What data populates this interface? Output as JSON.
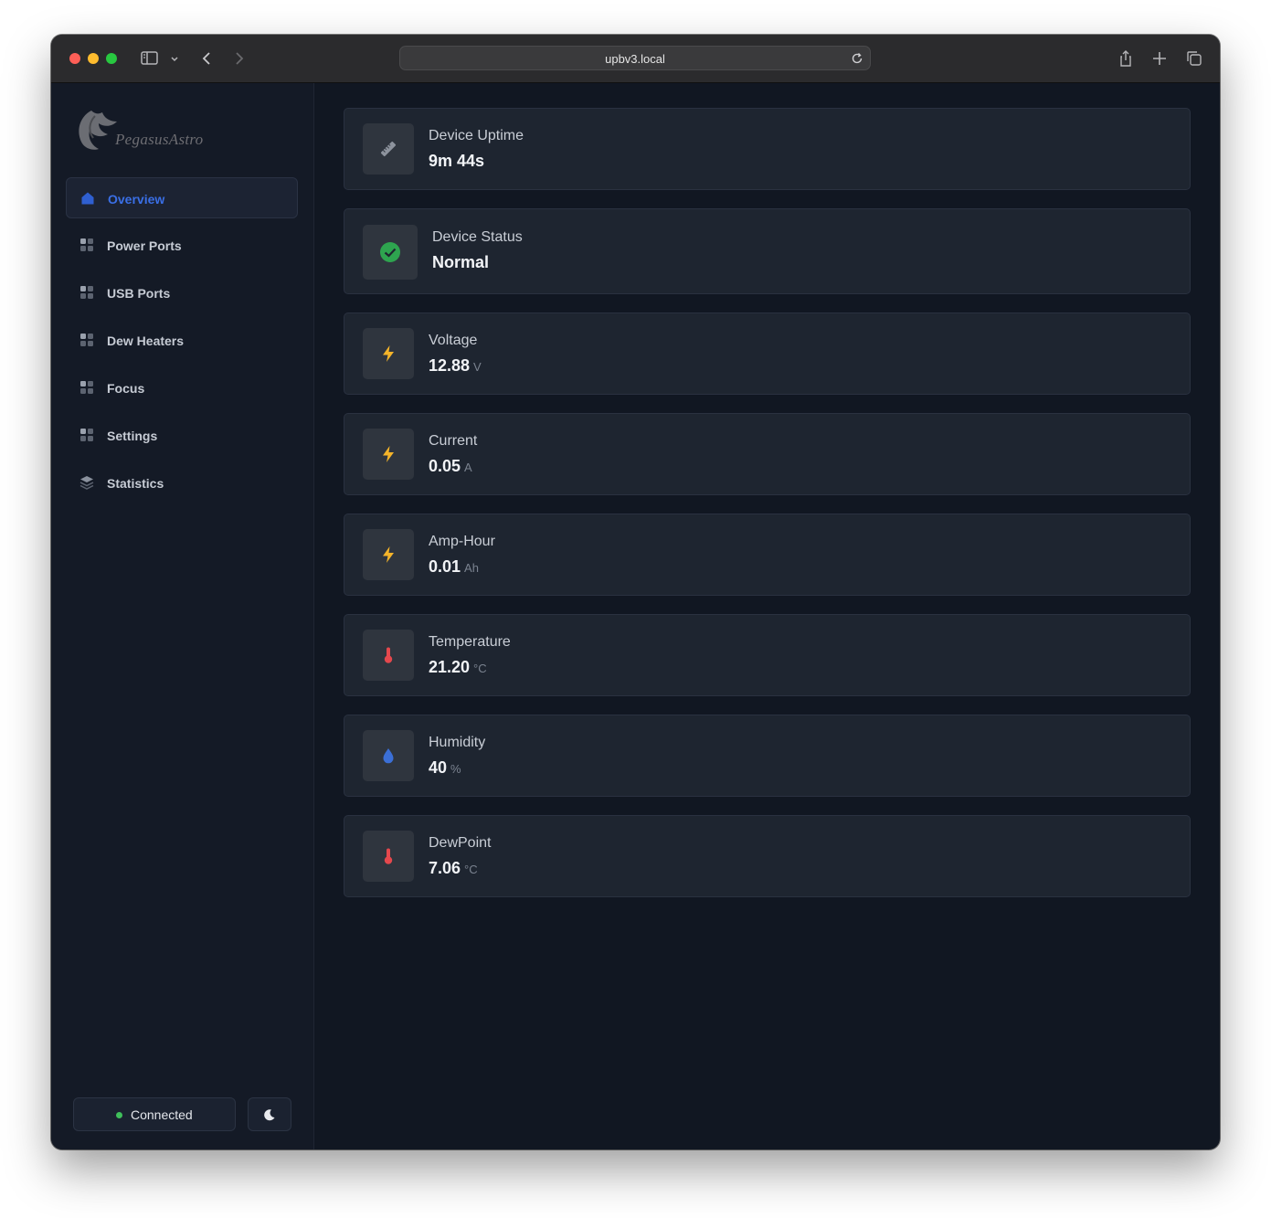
{
  "browser": {
    "url": "upbv3.local"
  },
  "sidebar": {
    "logo_text": "PegasusAstro",
    "items": [
      {
        "label": "Overview",
        "icon": "home-icon",
        "active": true
      },
      {
        "label": "Power Ports",
        "icon": "grid-icon"
      },
      {
        "label": "USB Ports",
        "icon": "grid-icon"
      },
      {
        "label": "Dew Heaters",
        "icon": "grid-icon"
      },
      {
        "label": "Focus",
        "icon": "grid-icon"
      },
      {
        "label": "Settings",
        "icon": "grid-icon"
      },
      {
        "label": "Statistics",
        "icon": "layers-icon"
      }
    ],
    "status_label": "Connected",
    "status_color": "#3fbf5a",
    "theme_icon": "moon-icon"
  },
  "cards": [
    {
      "title": "Device Uptime",
      "value": "9m 44s",
      "unit": "",
      "icon": "ruler-icon"
    },
    {
      "title": "Device Status",
      "value": "Normal",
      "unit": "",
      "icon": "check-circle-icon",
      "icon_color": "#2ea44f"
    },
    {
      "title": "Voltage",
      "value": "12.88",
      "unit": "V",
      "icon": "bolt-icon",
      "icon_color": "#f4b42a"
    },
    {
      "title": "Current",
      "value": "0.05",
      "unit": "A",
      "icon": "bolt-icon",
      "icon_color": "#f4b42a"
    },
    {
      "title": "Amp-Hour",
      "value": "0.01",
      "unit": "Ah",
      "icon": "bolt-icon",
      "icon_color": "#f4b42a"
    },
    {
      "title": "Temperature",
      "value": "21.20",
      "unit": "°C",
      "icon": "thermometer-icon",
      "icon_color": "#e5484d"
    },
    {
      "title": "Humidity",
      "value": "40",
      "unit": "%",
      "icon": "droplet-icon",
      "icon_color": "#3b6fd6"
    },
    {
      "title": "DewPoint",
      "value": "7.06",
      "unit": "°C",
      "icon": "thermometer-icon",
      "icon_color": "#e5484d"
    }
  ]
}
